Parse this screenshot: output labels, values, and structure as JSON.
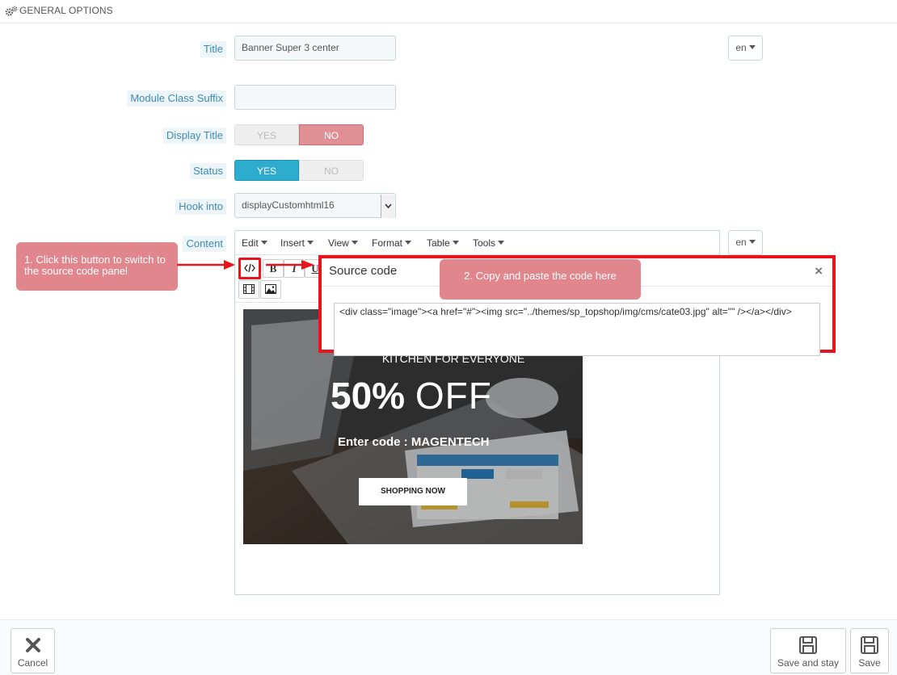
{
  "header": {
    "title": "GENERAL OPTIONS"
  },
  "form": {
    "title_label": "Title",
    "title_value": "Banner Super 3 center",
    "lang": "en",
    "suffix_label": "Module Class Suffix",
    "suffix_value": "",
    "display_title_label": "Display Title",
    "display_title": {
      "yes": "YES",
      "no": "NO",
      "selected": "NO"
    },
    "status_label": "Status",
    "status": {
      "yes": "YES",
      "no": "NO",
      "selected": "YES"
    },
    "hook_label": "Hook into",
    "hook_value": "displayCustomhtml16",
    "content_label": "Content",
    "content_lang": "en"
  },
  "editor": {
    "menus": [
      "Edit",
      "Insert",
      "View",
      "Format",
      "Table",
      "Tools"
    ],
    "toolbar": {
      "bold": "B",
      "italic": "I",
      "underline": "U"
    }
  },
  "banner": {
    "line1": "KITCHEN FOR EVERYONE",
    "discount_bold": "50%",
    "discount_light": "OFF",
    "code_line": "Enter code : MAGENTECH",
    "cta": "SHOPPING NOW"
  },
  "source_modal": {
    "title": "Source code",
    "close": "×",
    "code": "<div class=\"image\"><a href=\"#\"><img src=\"../themes/sp_topshop/img/cms/cate03.jpg\" alt=\"\" /></a></div>"
  },
  "callouts": {
    "step1": "1. Click this button to switch to the source code panel",
    "step2": "2. Copy and paste the code here"
  },
  "footer": {
    "cancel": "Cancel",
    "save_stay": "Save and stay",
    "save": "Save"
  },
  "colors": {
    "label_text": "#3b8bb4",
    "toggle_yes": "#2eacce",
    "toggle_no": "#e08f95",
    "highlight_red": "#e8141c",
    "callout": "#e0868c"
  }
}
